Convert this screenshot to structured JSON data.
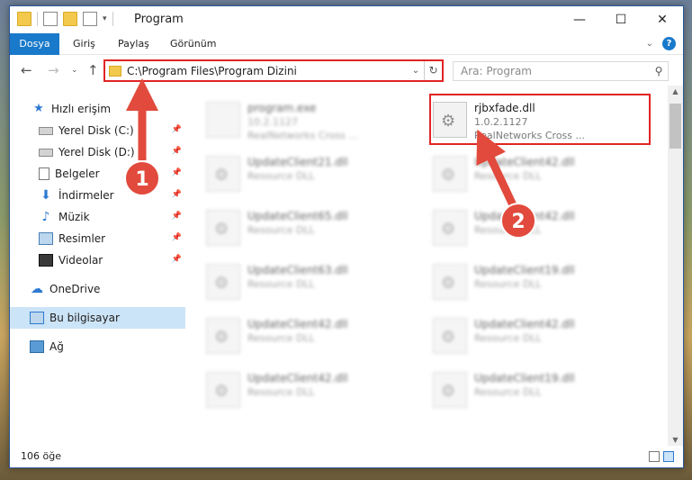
{
  "window": {
    "title": "Program",
    "controls": {
      "minimize": "—",
      "maximize": "☐",
      "close": "✕"
    }
  },
  "ribbon": {
    "tabs": [
      "Dosya",
      "Giriş",
      "Paylaş",
      "Görünüm"
    ],
    "help_label": "?"
  },
  "navbar": {
    "address": "C:\\Program Files\\Program Dizini",
    "search_placeholder": "Ara: Program"
  },
  "sidebar": {
    "items": [
      {
        "label": "Hızlı erişim",
        "icon": "star-icon",
        "pinned": false
      },
      {
        "label": "Yerel Disk (C:)",
        "icon": "disk-icon",
        "pinned": true
      },
      {
        "label": "Yerel Disk (D:)",
        "icon": "disk-icon",
        "pinned": true
      },
      {
        "label": "Belgeler",
        "icon": "documents-icon",
        "pinned": true
      },
      {
        "label": "İndirmeler",
        "icon": "downloads-icon",
        "pinned": true
      },
      {
        "label": "Müzik",
        "icon": "music-icon",
        "pinned": true
      },
      {
        "label": "Resimler",
        "icon": "pictures-icon",
        "pinned": true
      },
      {
        "label": "Videolar",
        "icon": "videos-icon",
        "pinned": true
      },
      {
        "label": "OneDrive",
        "icon": "onedrive-icon",
        "pinned": false
      },
      {
        "label": "Bu bilgisayar",
        "icon": "this-pc-icon",
        "pinned": false,
        "selected": true
      },
      {
        "label": "Ağ",
        "icon": "network-icon",
        "pinned": false
      }
    ]
  },
  "files": [
    {
      "name": "program.exe",
      "line2": "10.2.1127",
      "line3": "RealNetworks Cross ..."
    },
    {
      "name": "rjbxfade.dll",
      "line2": "1.0.2.1127",
      "line3": "RealNetworks Cross ..."
    },
    {
      "name": "UpdateClient21.dll",
      "line2": "Resource DLL",
      "line3": ""
    },
    {
      "name": "UpdateClient42.dll",
      "line2": "Resource DLL",
      "line3": ""
    },
    {
      "name": "UpdateClient65.dll",
      "line2": "Resource DLL",
      "line3": ""
    },
    {
      "name": "UpdateClient42.dll",
      "line2": "Resource DLL",
      "line3": ""
    },
    {
      "name": "UpdateClient63.dll",
      "line2": "Resource DLL",
      "line3": ""
    },
    {
      "name": "UpdateClient19.dll",
      "line2": "Resource DLL",
      "line3": ""
    },
    {
      "name": "UpdateClient42.dll",
      "line2": "Resource DLL",
      "line3": ""
    },
    {
      "name": "UpdateClient42.dll",
      "line2": "Resource DLL",
      "line3": ""
    },
    {
      "name": "UpdateClient42.dll",
      "line2": "Resource DLL",
      "line3": ""
    },
    {
      "name": "UpdateClient19.dll",
      "line2": "Resource DLL",
      "line3": ""
    }
  ],
  "status": {
    "count": "106 öğe"
  },
  "annotations": {
    "callout_1": "1",
    "callout_2": "2",
    "color": "#e14a3c"
  },
  "colors": {
    "accent": "#1979ca",
    "highlight": "#e02424",
    "selected": "#cce4f7"
  }
}
